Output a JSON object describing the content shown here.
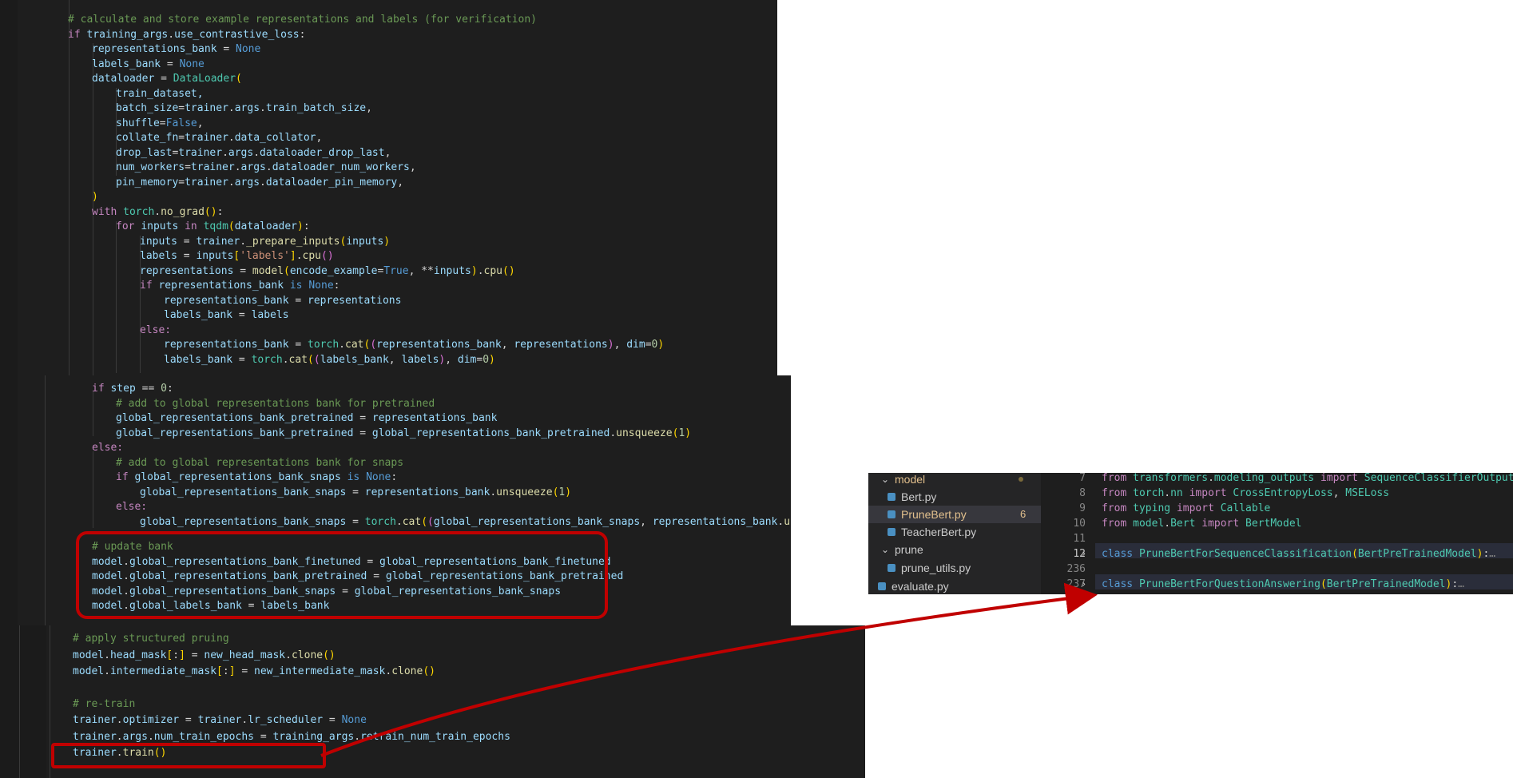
{
  "code_top": [
    "# calculate and store example representations and labels (for verification)",
    "if training_args.use_contrastive_loss:",
    "representations_bank = None",
    "labels_bank = None",
    "dataloader = DataLoader(",
    "train_dataset,",
    "batch_size=trainer.args.train_batch_size,",
    "shuffle=False,",
    "collate_fn=trainer.data_collator,",
    "drop_last=trainer.args.dataloader_drop_last,",
    "num_workers=trainer.args.dataloader_num_workers,",
    "pin_memory=trainer.args.dataloader_pin_memory,",
    ")",
    "with torch.no_grad():",
    "for inputs in tqdm(dataloader):",
    "inputs = trainer._prepare_inputs(inputs)",
    "labels = inputs['labels'].cpu()",
    "representations = model(encode_example=True, **inputs).cpu()",
    "if representations_bank is None:",
    "representations_bank = representations",
    "labels_bank = labels",
    "else:",
    "representations_bank = torch.cat((representations_bank, representations), dim=0)",
    "labels_bank = torch.cat((labels_bank, labels), dim=0)"
  ],
  "code_mid": [
    "if step == 0:",
    "# add to global representations bank for pretrained",
    "global_representations_bank_pretrained = representations_bank",
    "global_representations_bank_pretrained = global_representations_bank_pretrained.unsqueeze(1)",
    "else:",
    "# add to global representations bank for snaps",
    "if global_representations_bank_snaps is None:",
    "global_representations_bank_snaps = representations_bank.unsqueeze(1)",
    "else:",
    "global_representations_bank_snaps = torch.cat((global_representations_bank_snaps, representations_bank.unsque",
    "# update bank",
    "model.global_representations_bank_finetuned = global_representations_bank_finetuned",
    "model.global_representations_bank_pretrained = global_representations_bank_pretrained",
    "model.global_representations_bank_snaps = global_representations_bank_snaps",
    "model.global_labels_bank = labels_bank"
  ],
  "code_bot": [
    "# apply structured pruing",
    "model.head_mask[:] = new_head_mask.clone()",
    "model.intermediate_mask[:] = new_intermediate_mask.clone()",
    "# re-train",
    "trainer.optimizer = trainer.lr_scheduler = None",
    "trainer.args.num_train_epochs = training_args.retrain_num_train_epochs",
    "trainer.train()"
  ],
  "explorer": {
    "folder_model": "model",
    "files_model": [
      "Bert.py",
      "PruneBert.py",
      "TeacherBert.py"
    ],
    "badge": "6",
    "folder_prune": "prune",
    "files_prune": [
      "prune_utils.py"
    ],
    "cutoff_file": "evaluate.py"
  },
  "editor": {
    "line_numbers": [
      "7",
      "8",
      "9",
      "10",
      "11",
      "12",
      "236",
      "237"
    ],
    "lines": [
      "from transformers.modeling_outputs import SequenceClassifierOutput,",
      "from torch.nn import CrossEntropyLoss, MSELoss",
      "from typing import Callable",
      "from model.Bert import BertModel",
      "",
      "class PruneBertForSequenceClassification(BertPreTrainedModel):…",
      "",
      "class PruneBertForQuestionAnswering(BertPreTrainedModel):…"
    ]
  },
  "colors": {
    "annotation": "#c00000",
    "editor_bg": "#1e1e1e",
    "sidebar_bg": "#252526"
  }
}
